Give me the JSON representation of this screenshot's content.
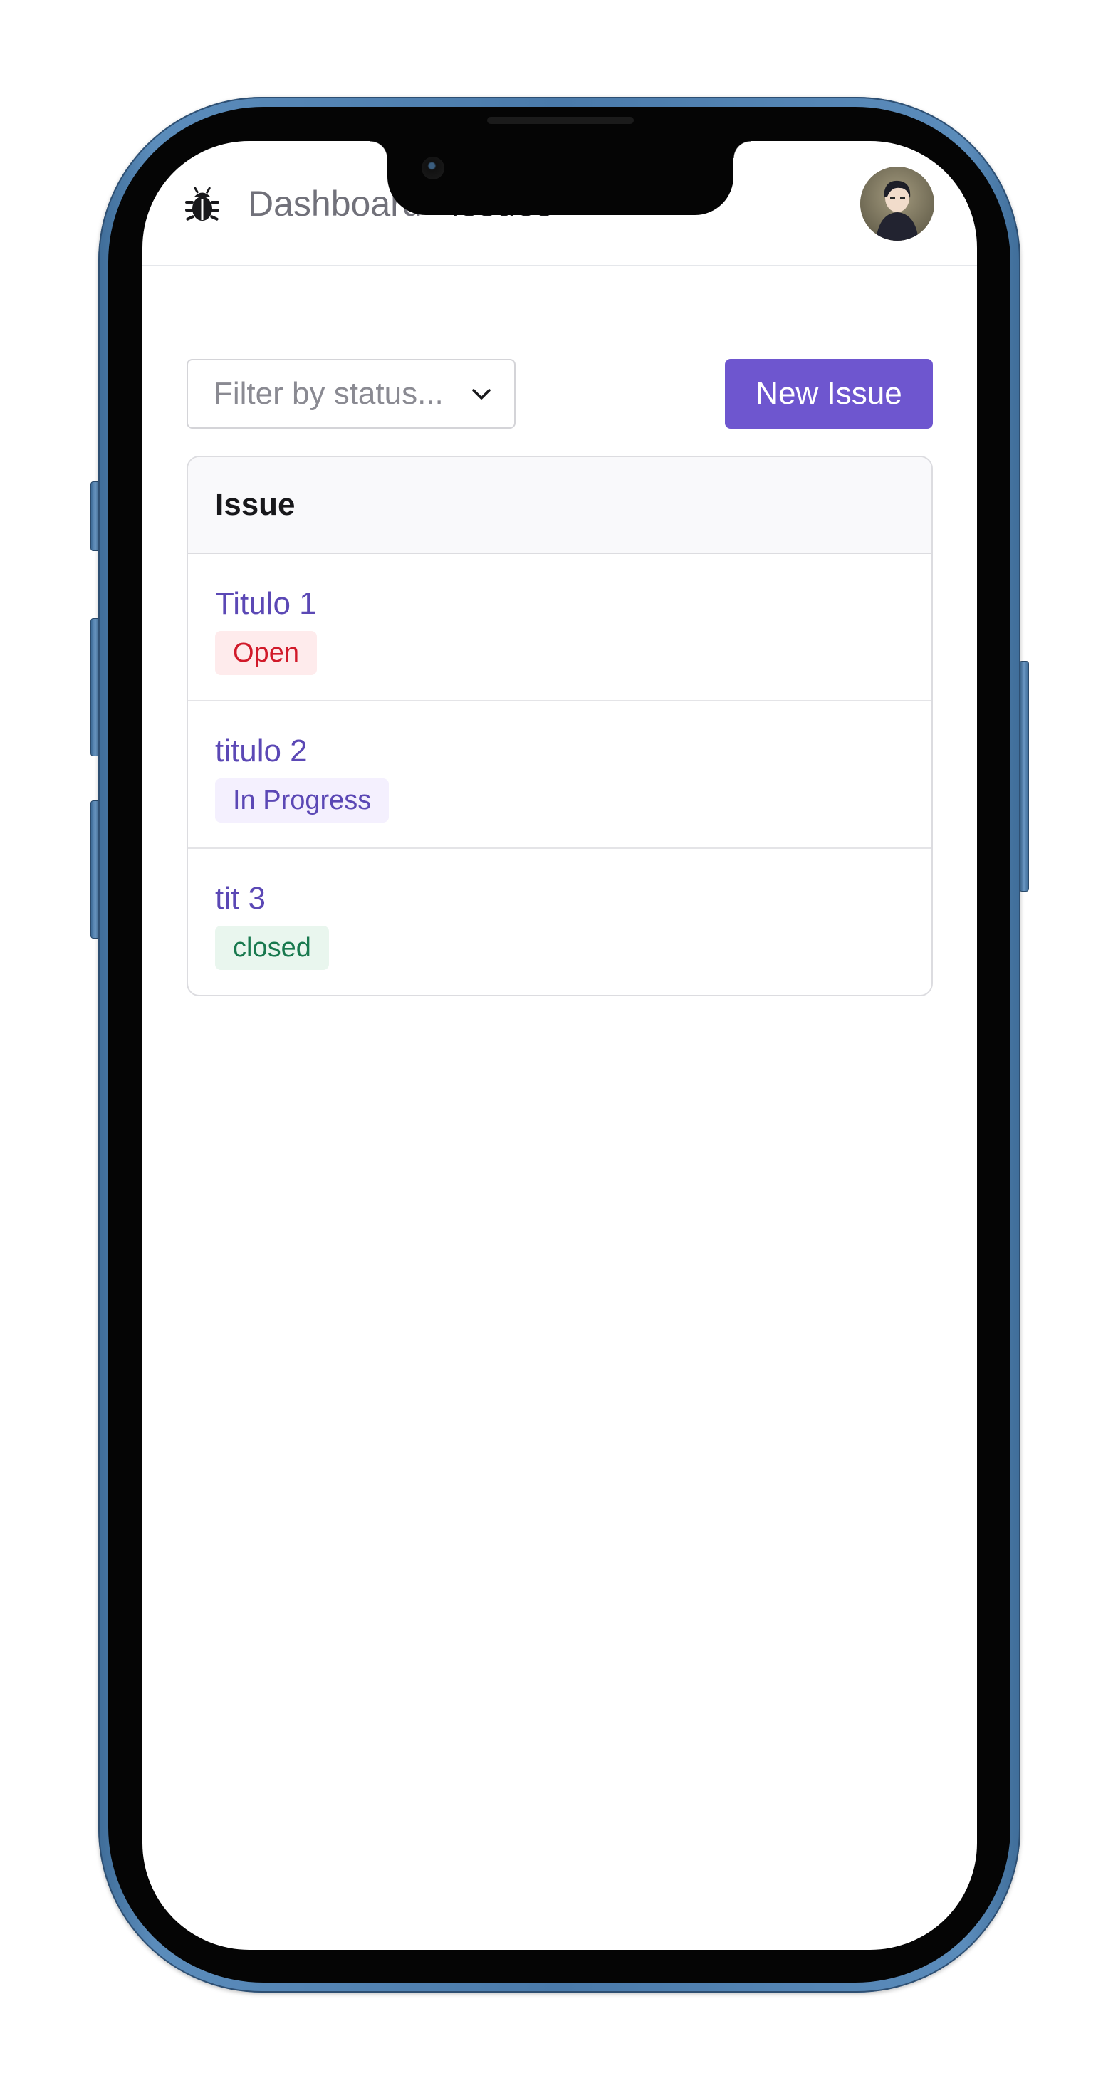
{
  "navbar": {
    "logo_icon": "bug-icon",
    "links": [
      {
        "label": "Dashboard",
        "active": false
      },
      {
        "label": "Issues",
        "active": true
      }
    ],
    "avatar_icon": "user-avatar"
  },
  "toolbar": {
    "filter_placeholder": "Filter by status...",
    "filter_icon": "chevron-down-icon",
    "new_issue_label": "New Issue",
    "accent_color": "#6e56cf"
  },
  "table": {
    "header": "Issue",
    "rows": [
      {
        "title": "Titulo 1",
        "status": "Open",
        "status_color": "#d11a2a",
        "status_bg": "#feebec"
      },
      {
        "title": "titulo 2",
        "status": "In Progress",
        "status_color": "#5b48b5",
        "status_bg": "#f4f0fe"
      },
      {
        "title": "tit 3",
        "status": "closed",
        "status_color": "#18794e",
        "status_bg": "#e9f6ee"
      }
    ]
  }
}
